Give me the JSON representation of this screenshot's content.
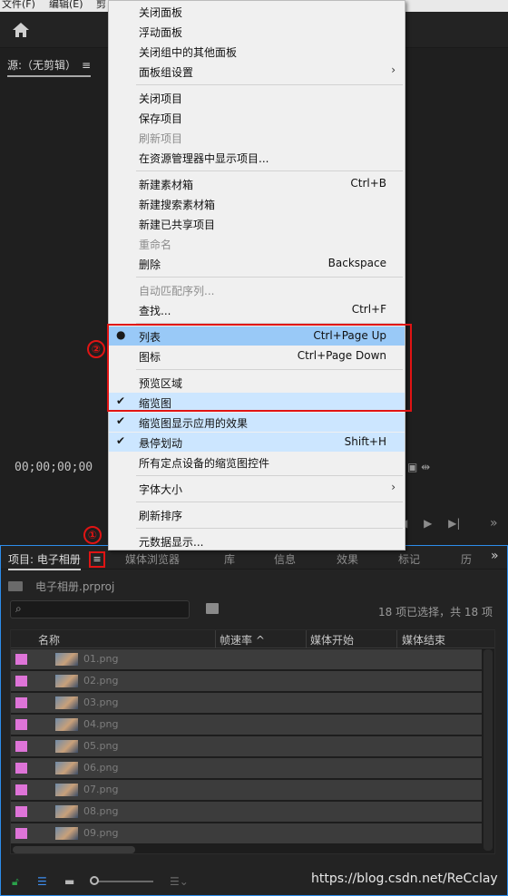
{
  "menubar": {
    "file": "文件(F)",
    "edit": "编辑(E)",
    "clip": "剪"
  },
  "source_panel": {
    "tab_label": "源:（无剪辑）",
    "timecode": "00;00;00;00",
    "small_icons": "▣ ⇹",
    "play_controls": [
      "◀",
      "▶",
      "▶|"
    ],
    "overflow": "»"
  },
  "project_panel": {
    "tabs": [
      "项目: 电子相册",
      "媒体浏览器",
      "库",
      "信息",
      "效果",
      "标记",
      "历"
    ],
    "hamburger": "≡",
    "overflow": "»",
    "project_file": "电子相册.prproj",
    "search_placeholder": "",
    "selection_count": "18 项已选择，共 18 项",
    "columns": [
      "名称",
      "帧速率",
      "媒体开始",
      "媒体结束"
    ],
    "sort_indicator": "^",
    "files": [
      "01.png",
      "02.png",
      "03.png",
      "04.png",
      "05.png",
      "06.png",
      "07.png",
      "08.png",
      "09.png"
    ],
    "label_color": "#de74d8",
    "bottom_icons": {
      "lock": "lock-icon",
      "list": "list-view-icon",
      "icon": "icon-view-icon"
    },
    "watermark": "https://blog.csdn.net/ReCclay"
  },
  "context_menu": {
    "items": [
      {
        "label": "关闭面板",
        "shortcut": ""
      },
      {
        "label": "浮动面板",
        "shortcut": ""
      },
      {
        "label": "关闭组中的其他面板",
        "shortcut": ""
      },
      {
        "label": "面板组设置",
        "shortcut": "",
        "submenu": true
      },
      {
        "label": "关闭项目",
        "shortcut": ""
      },
      {
        "label": "保存项目",
        "shortcut": ""
      },
      {
        "label": "刷新项目",
        "shortcut": "",
        "disabled": true
      },
      {
        "label": "在资源管理器中显示项目...",
        "shortcut": ""
      },
      {
        "label": "新建素材箱",
        "shortcut": "Ctrl+B"
      },
      {
        "label": "新建搜索素材箱",
        "shortcut": ""
      },
      {
        "label": "新建已共享项目",
        "shortcut": ""
      },
      {
        "label": "重命名",
        "shortcut": "",
        "disabled": true
      },
      {
        "label": "删除",
        "shortcut": "Backspace"
      },
      {
        "label": "自动匹配序列...",
        "shortcut": "",
        "disabled": true
      },
      {
        "label": "查找...",
        "shortcut": "Ctrl+F"
      },
      {
        "label": "列表",
        "shortcut": "Ctrl+Page Up",
        "mark": "●",
        "highlighted": true
      },
      {
        "label": "图标",
        "shortcut": "Ctrl+Page Down"
      },
      {
        "label": "预览区域",
        "shortcut": ""
      },
      {
        "label": "缩览图",
        "shortcut": "",
        "mark": "✔"
      },
      {
        "label": "缩览图显示应用的效果",
        "shortcut": "",
        "mark": "✔"
      },
      {
        "label": "悬停划动",
        "shortcut": "Shift+H",
        "mark": "✔"
      },
      {
        "label": "所有定点设备的缩览图控件",
        "shortcut": ""
      },
      {
        "label": "字体大小",
        "shortcut": "",
        "submenu": true
      },
      {
        "label": "刷新排序",
        "shortcut": ""
      },
      {
        "label": "元数据显示...",
        "shortcut": ""
      }
    ],
    "submenu_glyph": "›"
  },
  "annotations": {
    "one": "①",
    "two": "②"
  }
}
